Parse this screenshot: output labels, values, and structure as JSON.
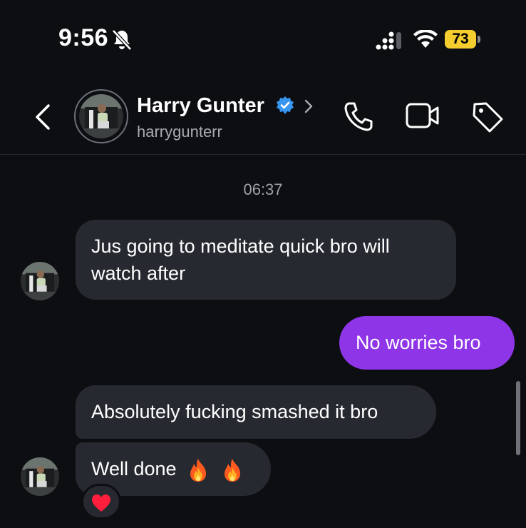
{
  "status_bar": {
    "time": "9:56",
    "battery": "73"
  },
  "contact": {
    "name": "Harry Gunter",
    "username": "harrygunterr"
  },
  "messages": {
    "timestamp": "06:37",
    "incoming_1": "Jus going to meditate quick bro will watch after",
    "outgoing_1": "No worries bro",
    "incoming_2": "Absolutely fucking smashed it bro",
    "incoming_3": "Well done"
  },
  "reaction": "heart",
  "colors": {
    "background": "#0c0e12",
    "incoming_bubble": "#262a30",
    "outgoing_bubble": "#8e35e8",
    "verified": "#3797f0",
    "battery": "#f5cd2e"
  },
  "icons": [
    "bell-slash-icon",
    "signal-icon",
    "wifi-icon",
    "battery-icon",
    "back-icon",
    "verified-icon",
    "chevron-right-icon",
    "phone-icon",
    "video-icon",
    "tag-icon",
    "fire-icon",
    "heart-icon"
  ]
}
